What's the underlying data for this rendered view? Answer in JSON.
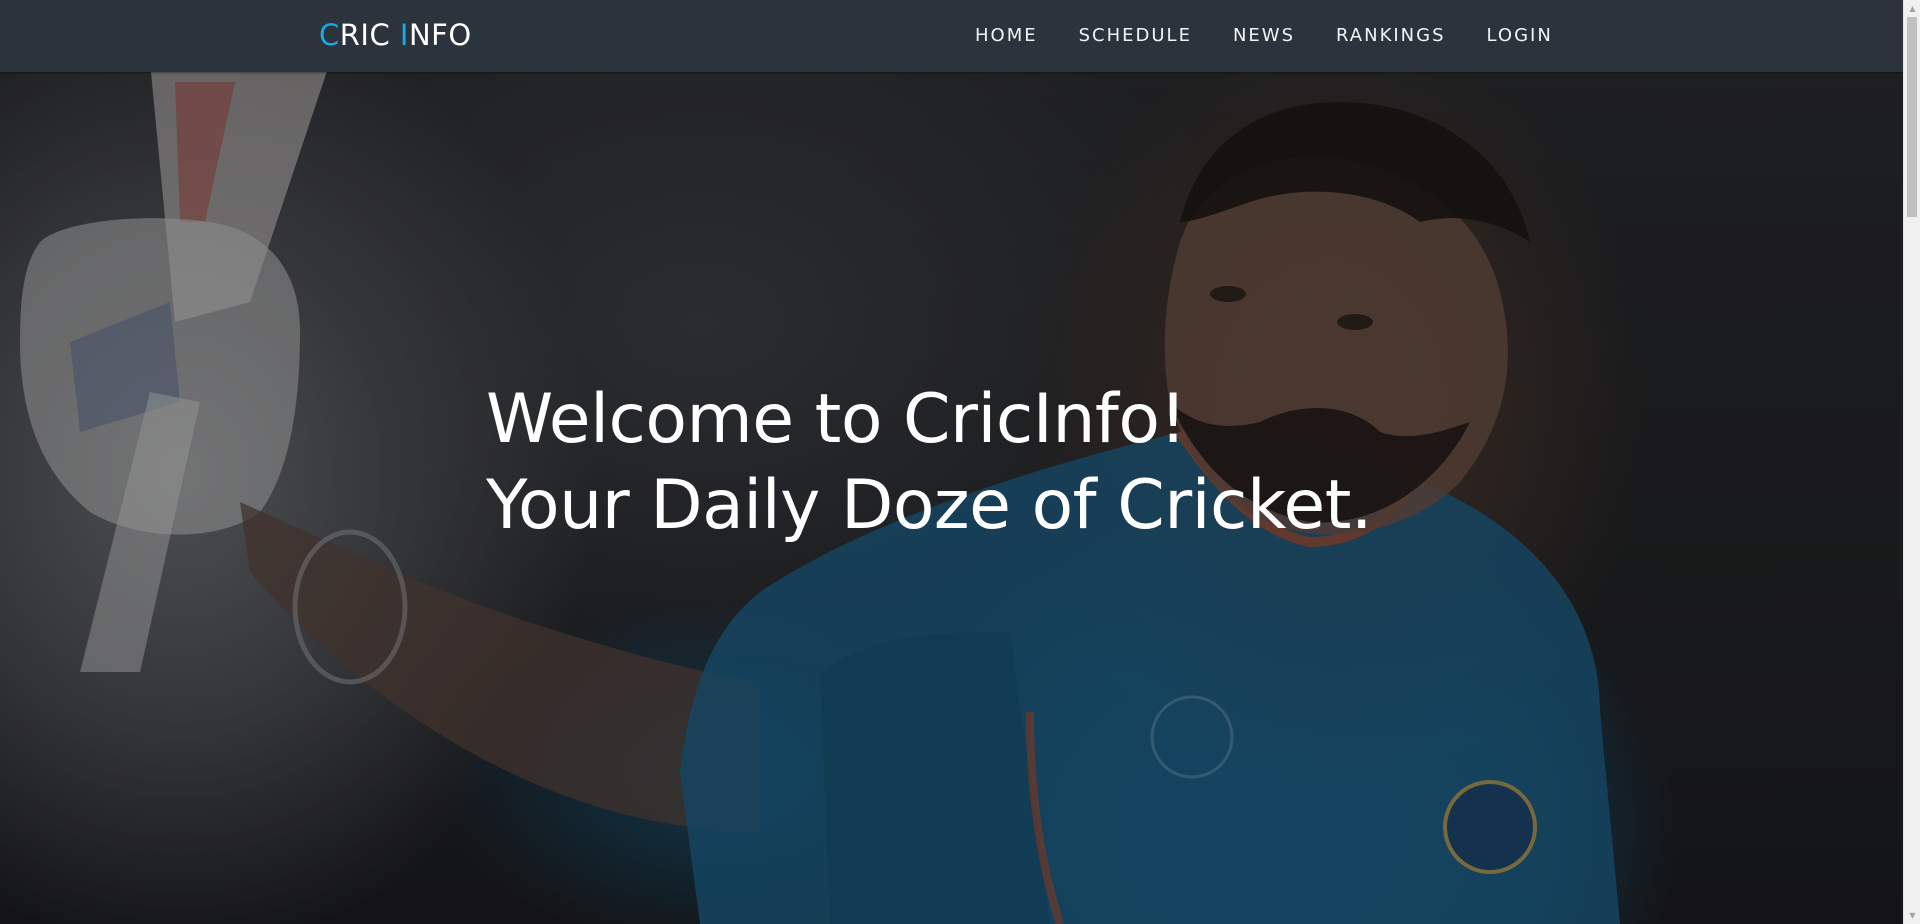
{
  "brand": {
    "first_initial": "C",
    "first_rest": "RIC",
    "second_initial": "I",
    "second_rest": "NFO",
    "accent_color": "#18a9e6"
  },
  "nav": {
    "items": [
      {
        "label": "HOME"
      },
      {
        "label": "SCHEDULE"
      },
      {
        "label": "NEWS"
      },
      {
        "label": "RANKINGS"
      },
      {
        "label": "LOGIN"
      }
    ]
  },
  "hero": {
    "line1": "Welcome to CricInfo!",
    "line2": "Your Daily Doze of Cricket."
  },
  "colors": {
    "navbar_bg": "#2b343c",
    "text": "#ffffff"
  },
  "icons": {
    "scroll_up": "triangle-up-icon",
    "scroll_down": "triangle-down-icon"
  }
}
